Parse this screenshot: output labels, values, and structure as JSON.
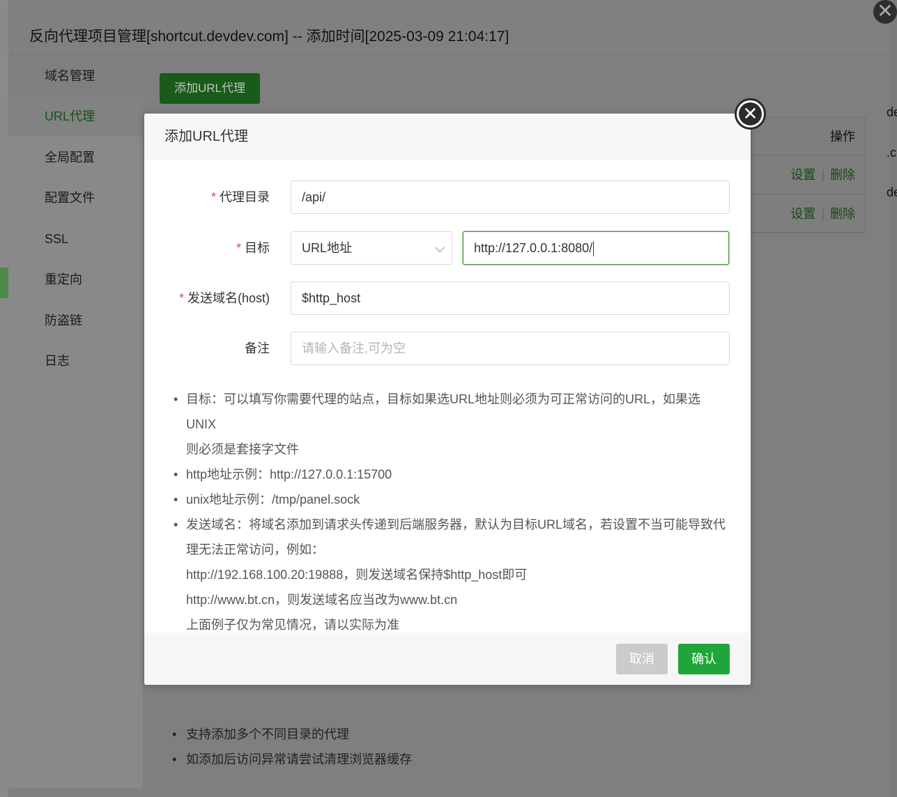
{
  "window": {
    "title": "反向代理项目管理[shortcut.devdev.com] -- 添加时间[2025-03-09 21:04:17]",
    "close_glyph": "✕"
  },
  "sidebar": {
    "items": [
      {
        "label": "域名管理"
      },
      {
        "label": "URL代理"
      },
      {
        "label": "全局配置"
      },
      {
        "label": "配置文件"
      },
      {
        "label": "SSL"
      },
      {
        "label": "重定向"
      },
      {
        "label": "防盗链"
      },
      {
        "label": "日志"
      }
    ],
    "active_index": 1
  },
  "main": {
    "add_button_label": "添加URL代理",
    "table": {
      "header_action": "操作",
      "rows": [
        {
          "set": "设置",
          "sep": "|",
          "delete": "删除"
        },
        {
          "set": "设置",
          "sep": "|",
          "delete": "删除"
        }
      ]
    },
    "edge_texts": [
      "de",
      ".c",
      "de"
    ],
    "notes": [
      "支持添加多个不同目录的代理",
      "如添加后访问异常请尝试清理浏览器缓存"
    ]
  },
  "modal": {
    "title": "添加URL代理",
    "close_glyph": "✕",
    "required_mark": "*",
    "fields": {
      "proxy_dir": {
        "label": "代理目录",
        "value": "/api/"
      },
      "target": {
        "label": "目标",
        "type_value": "URL地址",
        "url_value": "http://127.0.0.1:8080/"
      },
      "host": {
        "label": "发送域名(host)",
        "value": "$http_host"
      },
      "remark": {
        "label": "备注",
        "placeholder": "请输入备注,可为空"
      }
    },
    "tips": [
      {
        "lines": [
          "目标：可以填写你需要代理的站点，目标如果选URL地址则必须为可正常访问的URL，如果选UNIX",
          "则必须是套接字文件"
        ]
      },
      {
        "lines": [
          "http地址示例：http://127.0.0.1:15700"
        ]
      },
      {
        "lines": [
          "unix地址示例：/tmp/panel.sock"
        ]
      },
      {
        "lines": [
          "发送域名：将域名添加到请求头传递到后端服务器，默认为目标URL域名，若设置不当可能导致代",
          "理无法正常访问，例如：",
          "http://192.168.100.20:19888，则发送域名保持$http_host即可",
          "http://www.bt.cn，则发送域名应当改为www.bt.cn",
          "上面例子仅为常见情况，请以实际为准"
        ]
      }
    ],
    "buttons": {
      "cancel": "取消",
      "confirm": "确认"
    }
  },
  "colors": {
    "accent": "#20a53a",
    "required": "#e34a4a",
    "input_focus_border": "#4f9e3f"
  }
}
